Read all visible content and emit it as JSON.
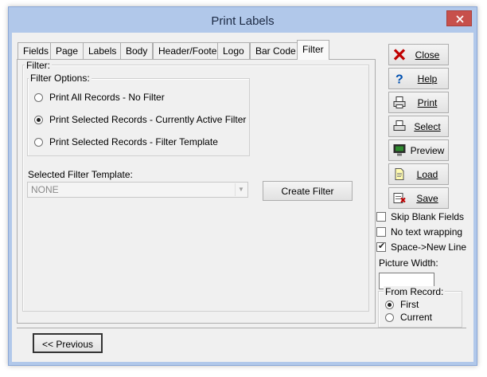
{
  "window": {
    "title": "Print Labels"
  },
  "tabs": [
    {
      "label": "Fields"
    },
    {
      "label": "Page"
    },
    {
      "label": "Labels"
    },
    {
      "label": "Body"
    },
    {
      "label": "Header/Footer"
    },
    {
      "label": "Logo"
    },
    {
      "label": "Bar Code"
    },
    {
      "label": "Filter"
    }
  ],
  "active_tab": "Filter",
  "filter": {
    "group_label": "Filter:",
    "options_label": "Filter Options:",
    "options": [
      {
        "label": "Print All Records - No Filter",
        "selected": false
      },
      {
        "label": "Print Selected Records - Currently Active Filter",
        "selected": true
      },
      {
        "label": "Print Selected Records - Filter Template",
        "selected": false
      }
    ],
    "template_label": "Selected Filter Template:",
    "template_value": "NONE",
    "create_button": "Create Filter"
  },
  "actions": [
    {
      "label": "Close",
      "icon": "red-x-icon"
    },
    {
      "label": "Help",
      "icon": "question-mark-icon"
    },
    {
      "label": "Print",
      "icon": "printer-icon"
    },
    {
      "label": "Select",
      "icon": "printer-select-icon"
    },
    {
      "label": "Preview",
      "icon": "monitor-icon"
    },
    {
      "label": "Load",
      "icon": "document-icon"
    },
    {
      "label": "Save",
      "icon": "save-icon"
    }
  ],
  "options": {
    "skip_blank_fields": {
      "label": "Skip Blank Fields",
      "checked": false
    },
    "no_text_wrapping": {
      "label": "No text wrapping",
      "checked": false
    },
    "space_new_line": {
      "label": "Space->New Line",
      "checked": true
    },
    "picture_width_label": "Picture Width:",
    "picture_width_value": ""
  },
  "from_record": {
    "label": "From Record:",
    "options": [
      {
        "label": "First",
        "selected": true
      },
      {
        "label": "Current",
        "selected": false
      }
    ]
  },
  "footer": {
    "previous_button": "<< Previous"
  }
}
